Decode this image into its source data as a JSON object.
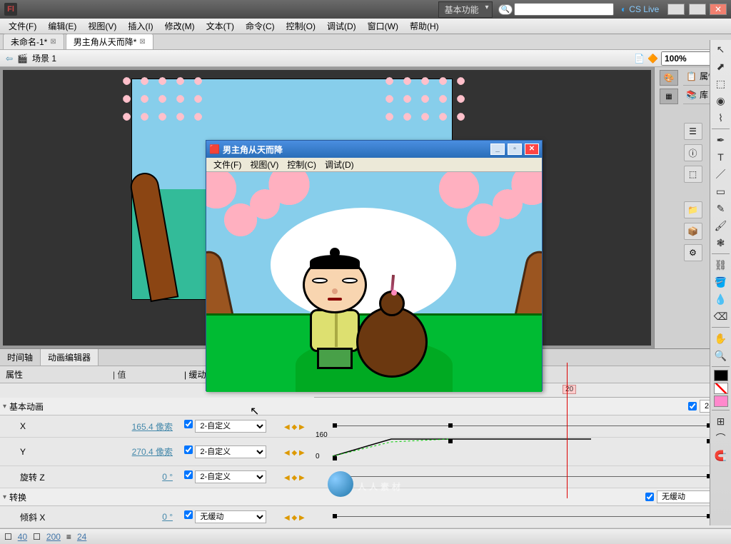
{
  "app": {
    "workspace": "基本功能",
    "cslive": "CS Live"
  },
  "menus": [
    "文件(F)",
    "编辑(E)",
    "视图(V)",
    "插入(I)",
    "修改(M)",
    "文本(T)",
    "命令(C)",
    "控制(O)",
    "调试(D)",
    "窗口(W)",
    "帮助(H)"
  ],
  "tabs": {
    "t1": "未命名-1*",
    "t2": "男主角从天而降*"
  },
  "scene": {
    "label": "场景 1",
    "zoom": "100%"
  },
  "panels": {
    "properties": "属性",
    "library": "库"
  },
  "preview": {
    "title": "男主角从天而降",
    "menus": [
      "文件(F)",
      "视图(V)",
      "控制(C)",
      "调试(D)"
    ]
  },
  "timeline": {
    "tab1": "时间轴",
    "tab2": "动画编辑器",
    "col_prop": "属性",
    "col_val": "值",
    "col_ease": "缓动",
    "group1": "基本动画",
    "group2": "转换",
    "rows": {
      "x": {
        "name": "X",
        "value": "165.4 像索"
      },
      "y": {
        "name": "Y",
        "value": "270.4 像索"
      },
      "rz": {
        "name": "旋转 Z",
        "value": "0 °"
      },
      "sx": {
        "name": "倾斜 X",
        "value": "0 °"
      }
    },
    "ease_custom": "2-自定义",
    "ease_none": "无缓动",
    "y_label": "160",
    "y_zero": "0",
    "frame20": "20"
  },
  "status": {
    "v1": "40",
    "v2": "200",
    "v3": "24"
  },
  "watermark": "人人素材"
}
